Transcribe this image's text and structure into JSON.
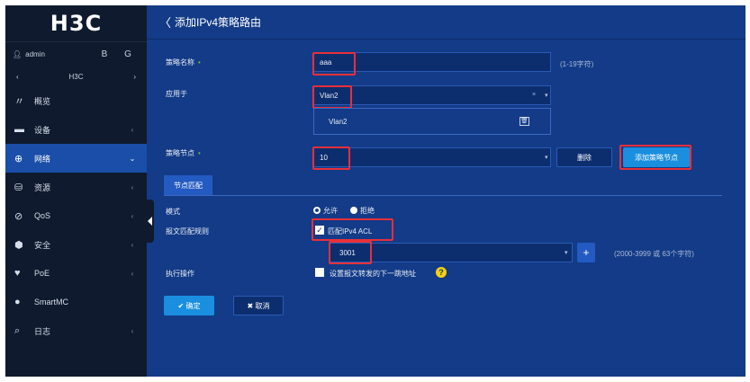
{
  "sidebar": {
    "logo": "H3C",
    "user": "admin",
    "save_icon": "B",
    "logout_icon": "G",
    "device": "H3C",
    "items": [
      {
        "icon": "〃",
        "label": "概览",
        "arrow": ""
      },
      {
        "icon": "▬",
        "label": "设备",
        "arrow": "‹"
      },
      {
        "icon": "⊕",
        "label": "网络",
        "arrow": "⌄"
      },
      {
        "icon": "⛁",
        "label": "资源",
        "arrow": "‹"
      },
      {
        "icon": "⊘",
        "label": "QoS",
        "arrow": "‹"
      },
      {
        "icon": "⬢",
        "label": "安全",
        "arrow": "‹"
      },
      {
        "icon": "♥",
        "label": "PoE",
        "arrow": "‹"
      },
      {
        "icon": "●",
        "label": "SmartMC",
        "arrow": ""
      },
      {
        "icon": "⌕",
        "label": "日志",
        "arrow": "‹"
      }
    ]
  },
  "header": {
    "back": "〈",
    "title": "添加IPv4策略路由"
  },
  "form": {
    "policy_name_label": "策略名称",
    "required_mark": "•",
    "policy_name_value": "aaa",
    "policy_name_hint": "(1-19字符)",
    "apply_label": "应用于",
    "apply_value": "Vlan2",
    "apply_clear": "×",
    "apply_selected_item": "Vlan2",
    "node_label": "策略节点",
    "node_value": "10",
    "delete_button": "删除",
    "add_node_button": "添加策略节点",
    "node_tab": "节点匹配",
    "mode_label": "模式",
    "mode_allow": "允许",
    "mode_deny": "拒绝",
    "rule_label": "报文匹配规则",
    "match_acl_label": "匹配IPv4 ACL",
    "acl_value": "3001",
    "acl_hint": "(2000-3999 或 63个字符)",
    "action_label": "执行操作",
    "action_checkbox_label": "设置报文转发的下一跳地址",
    "ok_button": "✔ 确定",
    "cancel_button": "✖ 取消"
  },
  "colors": {
    "main_bg": "#133b87",
    "sidebar_bg": "#0f1a2e",
    "accent": "#1a8fe0",
    "highlight": "#e8303a"
  }
}
